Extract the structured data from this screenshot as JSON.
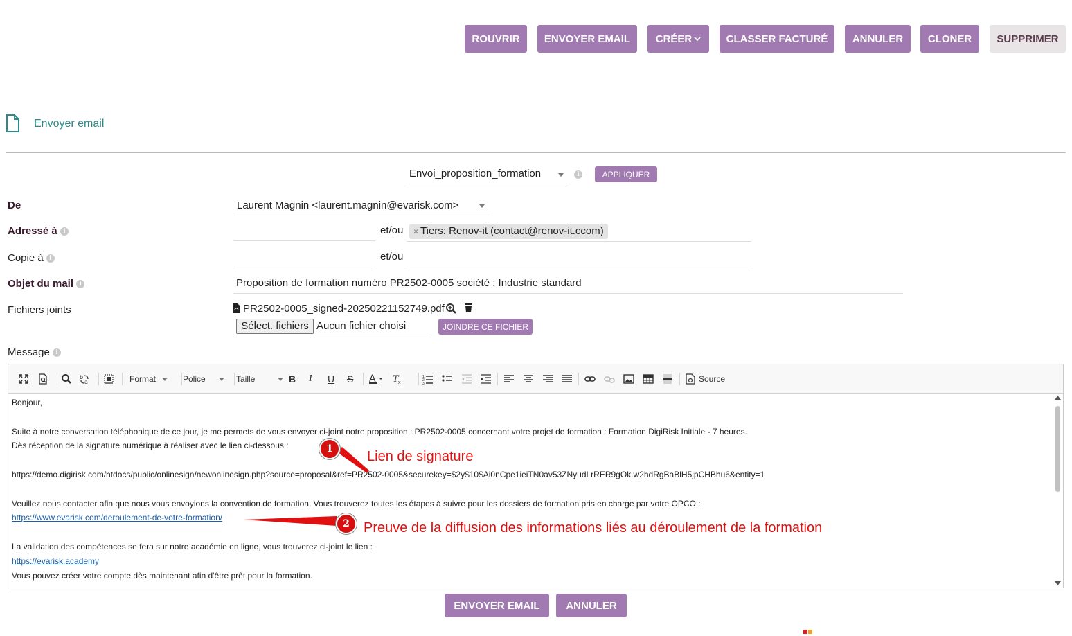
{
  "actions": [
    "ROUVRIR",
    "ENVOYER EMAIL",
    "CRÉER",
    "CLASSER FACTURÉ",
    "ANNULER",
    "CLONER",
    "SUPPRIMER"
  ],
  "page_title": "Envoyer email",
  "template": {
    "value": "Envoi_proposition_formation",
    "apply_label": "APPLIQUER"
  },
  "form": {
    "from_label": "De",
    "from_value": "Laurent Magnin <laurent.magnin@evarisk.com>",
    "to_label": "Adressé à",
    "and_or": "et/ou",
    "to_tag": "Tiers: Renov-it (contact@renov-it.ccom)",
    "to_tag_remove": "×",
    "cc_label": "Copie à",
    "cc_and_or": "et/ou",
    "subject_label": "Objet du mail",
    "subject_value": "Proposition de formation numéro PR2502-0005 société : Industrie standard",
    "files_label": "Fichiers joints",
    "file_name": "PR2502-0005_signed-20250221152749.pdf",
    "select_files_label": "Sélect. fichiers",
    "no_file_label": "Aucun fichier choisi",
    "attach_label": "JOINDRE CE FICHIER",
    "message_label": "Message"
  },
  "editor": {
    "toolbar": {
      "format": "Format",
      "font": "Police",
      "size": "Taille",
      "source": "Source"
    },
    "lines": {
      "l1": "Bonjour,",
      "l2": "Suite à notre conversation téléphonique de ce jour, je me permets de vous envoyer ci-joint notre proposition : PR2502-0005 concernant votre projet de formation : Formation DigiRisk Initiale - 7 heures.",
      "l3": "Dès réception de la signature numérique à réaliser avec le lien ci-dessous :",
      "l4": "https://demo.digirisk.com/htdocs/public/onlinesign/newonlinesign.php?source=proposal&ref=PR2502-0005&securekey=$2y$10$Ai0nCpe1ieiTN0av53ZNyudLrRER9gOk.w2hdRgBaBlH5jpCHBhu6&entity=1",
      "l5": "Veuillez nous contacter afin que nous vous envoyions la convention de formation. Vous trouverez toutes les étapes à suivre pour les dossiers de formation pris en charge par votre OPCO :",
      "l6": "https://www.evarisk.com/deroulement-de-votre-formation/",
      "l7": "La validation des compétences se fera sur notre académie en ligne, vous trouverez ci-joint le lien :",
      "l8": "https://evarisk.academy",
      "l9": "Vous pouvez créer votre compte dès maintenant afin d'être prêt pour la formation."
    }
  },
  "annotations": {
    "a1_num": "1",
    "a1_text": "Lien de signature",
    "a2_num": "2",
    "a2_text": "Preuve de la diffusion des informations liés au déroulement de la formation"
  },
  "bottom": {
    "send": "ENVOYER EMAIL",
    "cancel": "ANNULER"
  },
  "colors": {
    "primary": "#a07ab0",
    "title": "#2a8a8a",
    "annotation": "#e01010"
  }
}
